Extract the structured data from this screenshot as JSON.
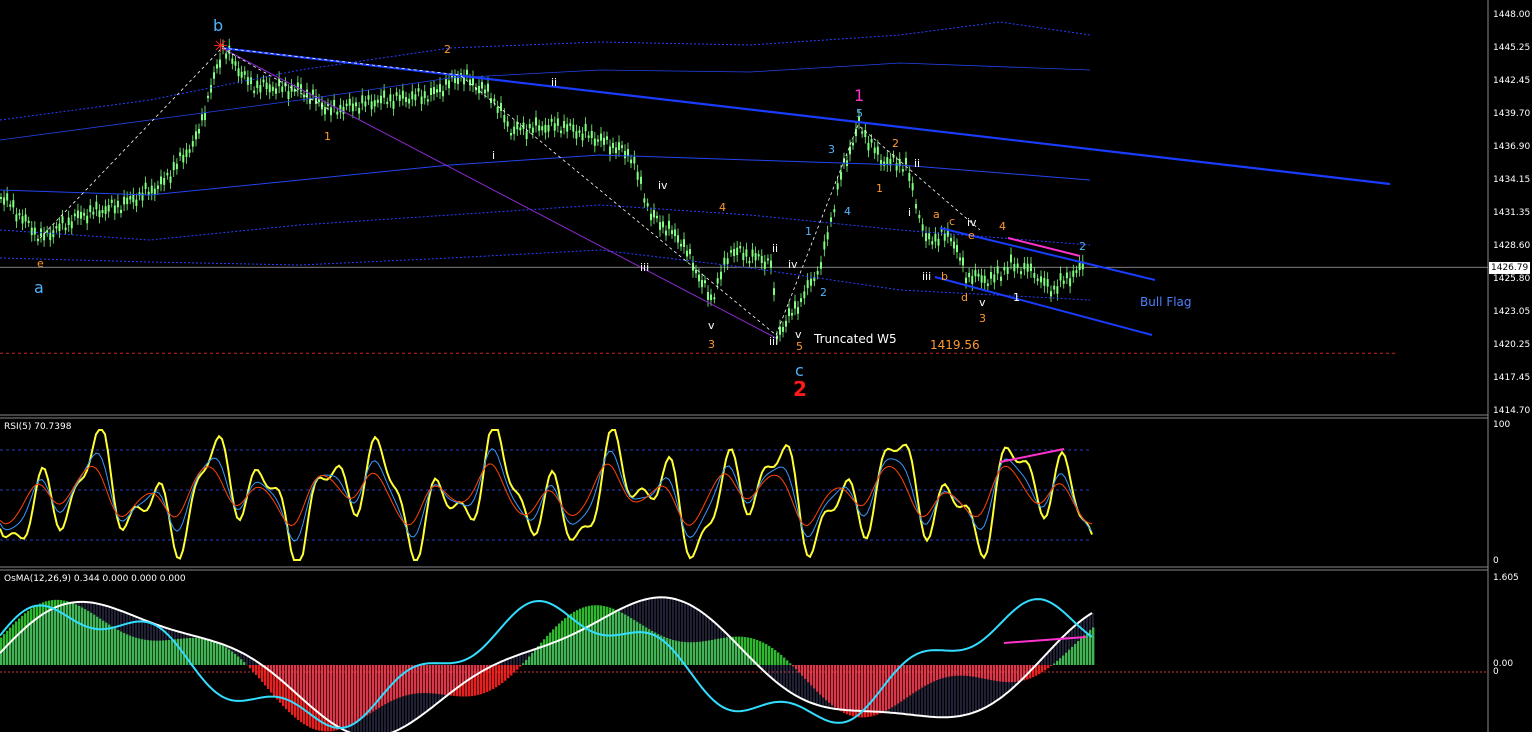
{
  "chart_data": [
    {
      "type": "candlestick",
      "title": "",
      "ylim": [
        1414.7,
        1448.0
      ],
      "y_ticks": [
        "1448.00",
        "1445.25",
        "1442.45",
        "1439.70",
        "1436.90",
        "1434.15",
        "1431.35",
        "1428.60",
        "1425.80",
        "1423.05",
        "1420.25",
        "1417.45",
        "1414.70"
      ],
      "current_price": "1426.79",
      "support_level": "1419.56",
      "grid": false,
      "wave_labels": [
        {
          "text": "b",
          "color": "#4fb3ff",
          "size": "big"
        },
        {
          "text": "a",
          "color": "#4fb3ff",
          "size": "big"
        },
        {
          "text": "e",
          "color": "#ff9933"
        },
        {
          "text": "2",
          "color": "#ff9933"
        },
        {
          "text": "1",
          "color": "#ff9933"
        },
        {
          "text": "ii",
          "color": "#ffffff"
        },
        {
          "text": "i",
          "color": "#ffffff"
        },
        {
          "text": "iv",
          "color": "#ffffff"
        },
        {
          "text": "4",
          "color": "#ff9933"
        },
        {
          "text": "iii",
          "color": "#ffffff"
        },
        {
          "text": "v",
          "color": "#ffffff"
        },
        {
          "text": "3",
          "color": "#ff9933"
        },
        {
          "text": "iii",
          "color": "#ffffff"
        },
        {
          "text": "ii",
          "color": "#ffffff"
        },
        {
          "text": "iv",
          "color": "#ffffff"
        },
        {
          "text": "v",
          "color": "#ffffff"
        },
        {
          "text": "5",
          "color": "#ff9933"
        },
        {
          "text": "c",
          "color": "#4fb3ff",
          "size": "big"
        },
        {
          "text": "2",
          "color": "#ff1a1a",
          "size": "huge"
        },
        {
          "text": "1",
          "color": "#4fb3ff"
        },
        {
          "text": "2",
          "color": "#4fb3ff"
        },
        {
          "text": "3",
          "color": "#4fb3ff"
        },
        {
          "text": "4",
          "color": "#4fb3ff"
        },
        {
          "text": "5",
          "color": "#4fb3ff"
        },
        {
          "text": "1",
          "color": "#ff33cc",
          "size": "big"
        },
        {
          "text": "2",
          "color": "#ff9933"
        },
        {
          "text": "1",
          "color": "#ff9933"
        },
        {
          "text": "ii",
          "color": "#ffffff"
        },
        {
          "text": "i",
          "color": "#ffffff"
        },
        {
          "text": "a",
          "color": "#ff9933"
        },
        {
          "text": "c",
          "color": "#ff9933"
        },
        {
          "text": "iv",
          "color": "#ffffff"
        },
        {
          "text": "4",
          "color": "#ff9933"
        },
        {
          "text": "e",
          "color": "#ff9933"
        },
        {
          "text": "2",
          "color": "#4fb3ff"
        },
        {
          "text": "iii",
          "color": "#ffffff"
        },
        {
          "text": "b",
          "color": "#ff9933"
        },
        {
          "text": "d",
          "color": "#ff9933"
        },
        {
          "text": "v",
          "color": "#ffffff"
        },
        {
          "text": "1",
          "color": "#ffffff"
        },
        {
          "text": "3",
          "color": "#ff9933"
        }
      ],
      "annotations": [
        {
          "text": "Truncated W5",
          "color": "#ffffff"
        },
        {
          "text": "1419.56",
          "color": "#ff9933"
        },
        {
          "text": "Bull Flag",
          "color": "#4f7fff"
        }
      ],
      "colors": {
        "candle_up": "#7fff7f",
        "candle_down": "#7fff7f",
        "trendline": "#1a3cff",
        "ma": "#2244ee",
        "bands": "#2a3fff",
        "support": "#cc2222",
        "divergence": "#ff33cc",
        "elliott_path": "#ffffff",
        "channel": "#8a2ad0"
      }
    },
    {
      "type": "line",
      "title": "RSI(5) 70.7398",
      "ylim": [
        0,
        100
      ],
      "y_ticks": [
        "100",
        "0"
      ],
      "series": [
        {
          "color": "#ffff33"
        },
        {
          "color": "#3399ff"
        },
        {
          "color": "#ff4400"
        }
      ],
      "colors": {
        "band": "#3355ff",
        "divergence": "#ff33cc"
      }
    },
    {
      "type": "histogram",
      "title": "OsMA(12,26,9) 0.344 0.000 0.000 0.000",
      "y_ticks": [
        "1.605",
        "0.00",
        "0"
      ],
      "series": [
        {
          "color": "#33cc33"
        },
        {
          "color": "#ff2222"
        },
        {
          "color": "#ffffff"
        },
        {
          "color": "#33ddff"
        }
      ],
      "colors": {
        "zero_line": "#cc3333",
        "divergence": "#ff33cc",
        "bars": "#9999ff"
      }
    }
  ]
}
